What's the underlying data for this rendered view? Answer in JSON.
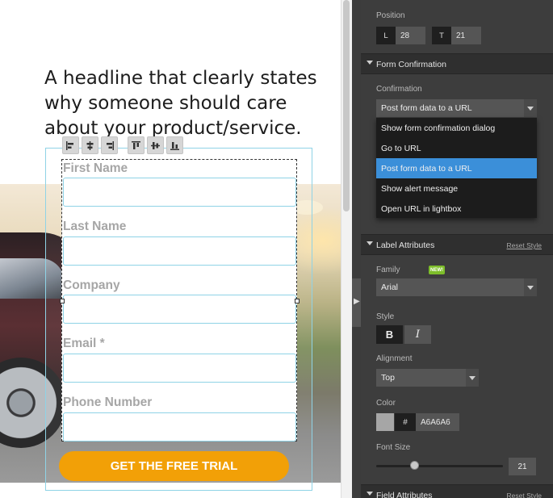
{
  "canvas": {
    "headline": "A headline that clearly states why someone should care about your product/service.",
    "form": {
      "fields": [
        {
          "label": "First Name"
        },
        {
          "label": "Last Name"
        },
        {
          "label": "Company"
        },
        {
          "label": "Email *"
        },
        {
          "label": "Phone Number"
        }
      ],
      "submit_label": "GET THE FREE TRIAL"
    },
    "align_tools": [
      "align-left-icon",
      "align-center-icon",
      "align-right-icon",
      "align-top-icon",
      "align-middle-icon",
      "align-bottom-icon"
    ]
  },
  "panel": {
    "position": {
      "label": "Position",
      "left_key": "L",
      "left_value": "28",
      "top_key": "T",
      "top_value": "21"
    },
    "form_confirmation": {
      "title": "Form Confirmation",
      "confirmation_label": "Confirmation",
      "selected": "Post form data to a URL",
      "options": [
        "Show form confirmation dialog",
        "Go to URL",
        "Post form data to a URL",
        "Show alert message",
        "Open URL in lightbox"
      ]
    },
    "label_attributes": {
      "title": "Label Attributes",
      "reset": "Reset Style",
      "family_label": "Family",
      "new_badge": "NEW!",
      "family_value": "Arial",
      "style_label": "Style",
      "bold_label": "B",
      "italic_label": "I",
      "alignment_label": "Alignment",
      "alignment_value": "Top",
      "color_label": "Color",
      "color_hash": "#",
      "color_value": "A6A6A6",
      "font_size_label": "Font Size",
      "font_size_value": "21",
      "font_size_slider_fraction": 0.3
    },
    "field_attributes": {
      "title": "Field Attributes",
      "reset": "Reset Style"
    }
  },
  "colors": {
    "cta": "#f2a007",
    "label": "#a6a6a6",
    "selection": "#3b8fd9",
    "panel_bg": "#3d3d3d",
    "frame": "#8fd3e6"
  }
}
